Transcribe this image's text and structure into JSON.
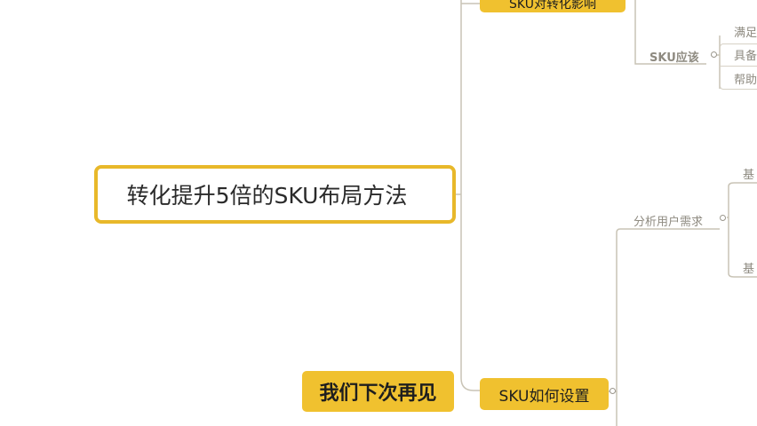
{
  "root": {
    "title": "转化提升5倍的SKU布局方法"
  },
  "top_branch": {
    "label": "SKU对转化影响"
  },
  "sku_should": {
    "label": "SKU应该",
    "items": [
      "满足",
      "具备",
      "帮助"
    ]
  },
  "sku_setup": {
    "label": "SKU如何设置"
  },
  "analyze": {
    "label": "分析用户需求",
    "items": [
      "基",
      "基"
    ]
  },
  "farewell": {
    "label": "我们下次再见"
  },
  "colors": {
    "accent": "#f0c12f",
    "root_border": "#e8b82a",
    "connector": "#c9c4b6",
    "muted_text": "#8e8a80"
  }
}
